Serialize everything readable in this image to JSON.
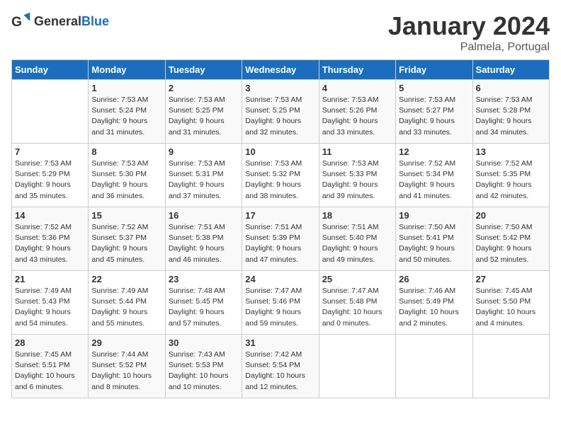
{
  "header": {
    "logo_general": "General",
    "logo_blue": "Blue",
    "month_title": "January 2024",
    "location": "Palmela, Portugal"
  },
  "days_of_week": [
    "Sunday",
    "Monday",
    "Tuesday",
    "Wednesday",
    "Thursday",
    "Friday",
    "Saturday"
  ],
  "weeks": [
    [
      {
        "day": "",
        "info": ""
      },
      {
        "day": "1",
        "info": "Sunrise: 7:53 AM\nSunset: 5:24 PM\nDaylight: 9 hours\nand 31 minutes."
      },
      {
        "day": "2",
        "info": "Sunrise: 7:53 AM\nSunset: 5:25 PM\nDaylight: 9 hours\nand 31 minutes."
      },
      {
        "day": "3",
        "info": "Sunrise: 7:53 AM\nSunset: 5:25 PM\nDaylight: 9 hours\nand 32 minutes."
      },
      {
        "day": "4",
        "info": "Sunrise: 7:53 AM\nSunset: 5:26 PM\nDaylight: 9 hours\nand 33 minutes."
      },
      {
        "day": "5",
        "info": "Sunrise: 7:53 AM\nSunset: 5:27 PM\nDaylight: 9 hours\nand 33 minutes."
      },
      {
        "day": "6",
        "info": "Sunrise: 7:53 AM\nSunset: 5:28 PM\nDaylight: 9 hours\nand 34 minutes."
      }
    ],
    [
      {
        "day": "7",
        "info": "Sunrise: 7:53 AM\nSunset: 5:29 PM\nDaylight: 9 hours\nand 35 minutes."
      },
      {
        "day": "8",
        "info": "Sunrise: 7:53 AM\nSunset: 5:30 PM\nDaylight: 9 hours\nand 36 minutes."
      },
      {
        "day": "9",
        "info": "Sunrise: 7:53 AM\nSunset: 5:31 PM\nDaylight: 9 hours\nand 37 minutes."
      },
      {
        "day": "10",
        "info": "Sunrise: 7:53 AM\nSunset: 5:32 PM\nDaylight: 9 hours\nand 38 minutes."
      },
      {
        "day": "11",
        "info": "Sunrise: 7:53 AM\nSunset: 5:33 PM\nDaylight: 9 hours\nand 39 minutes."
      },
      {
        "day": "12",
        "info": "Sunrise: 7:52 AM\nSunset: 5:34 PM\nDaylight: 9 hours\nand 41 minutes."
      },
      {
        "day": "13",
        "info": "Sunrise: 7:52 AM\nSunset: 5:35 PM\nDaylight: 9 hours\nand 42 minutes."
      }
    ],
    [
      {
        "day": "14",
        "info": "Sunrise: 7:52 AM\nSunset: 5:36 PM\nDaylight: 9 hours\nand 43 minutes."
      },
      {
        "day": "15",
        "info": "Sunrise: 7:52 AM\nSunset: 5:37 PM\nDaylight: 9 hours\nand 45 minutes."
      },
      {
        "day": "16",
        "info": "Sunrise: 7:51 AM\nSunset: 5:38 PM\nDaylight: 9 hours\nand 46 minutes."
      },
      {
        "day": "17",
        "info": "Sunrise: 7:51 AM\nSunset: 5:39 PM\nDaylight: 9 hours\nand 47 minutes."
      },
      {
        "day": "18",
        "info": "Sunrise: 7:51 AM\nSunset: 5:40 PM\nDaylight: 9 hours\nand 49 minutes."
      },
      {
        "day": "19",
        "info": "Sunrise: 7:50 AM\nSunset: 5:41 PM\nDaylight: 9 hours\nand 50 minutes."
      },
      {
        "day": "20",
        "info": "Sunrise: 7:50 AM\nSunset: 5:42 PM\nDaylight: 9 hours\nand 52 minutes."
      }
    ],
    [
      {
        "day": "21",
        "info": "Sunrise: 7:49 AM\nSunset: 5:43 PM\nDaylight: 9 hours\nand 54 minutes."
      },
      {
        "day": "22",
        "info": "Sunrise: 7:49 AM\nSunset: 5:44 PM\nDaylight: 9 hours\nand 55 minutes."
      },
      {
        "day": "23",
        "info": "Sunrise: 7:48 AM\nSunset: 5:45 PM\nDaylight: 9 hours\nand 57 minutes."
      },
      {
        "day": "24",
        "info": "Sunrise: 7:47 AM\nSunset: 5:46 PM\nDaylight: 9 hours\nand 59 minutes."
      },
      {
        "day": "25",
        "info": "Sunrise: 7:47 AM\nSunset: 5:48 PM\nDaylight: 10 hours\nand 0 minutes."
      },
      {
        "day": "26",
        "info": "Sunrise: 7:46 AM\nSunset: 5:49 PM\nDaylight: 10 hours\nand 2 minutes."
      },
      {
        "day": "27",
        "info": "Sunrise: 7:45 AM\nSunset: 5:50 PM\nDaylight: 10 hours\nand 4 minutes."
      }
    ],
    [
      {
        "day": "28",
        "info": "Sunrise: 7:45 AM\nSunset: 5:51 PM\nDaylight: 10 hours\nand 6 minutes."
      },
      {
        "day": "29",
        "info": "Sunrise: 7:44 AM\nSunset: 5:52 PM\nDaylight: 10 hours\nand 8 minutes."
      },
      {
        "day": "30",
        "info": "Sunrise: 7:43 AM\nSunset: 5:53 PM\nDaylight: 10 hours\nand 10 minutes."
      },
      {
        "day": "31",
        "info": "Sunrise: 7:42 AM\nSunset: 5:54 PM\nDaylight: 10 hours\nand 12 minutes."
      },
      {
        "day": "",
        "info": ""
      },
      {
        "day": "",
        "info": ""
      },
      {
        "day": "",
        "info": ""
      }
    ]
  ]
}
